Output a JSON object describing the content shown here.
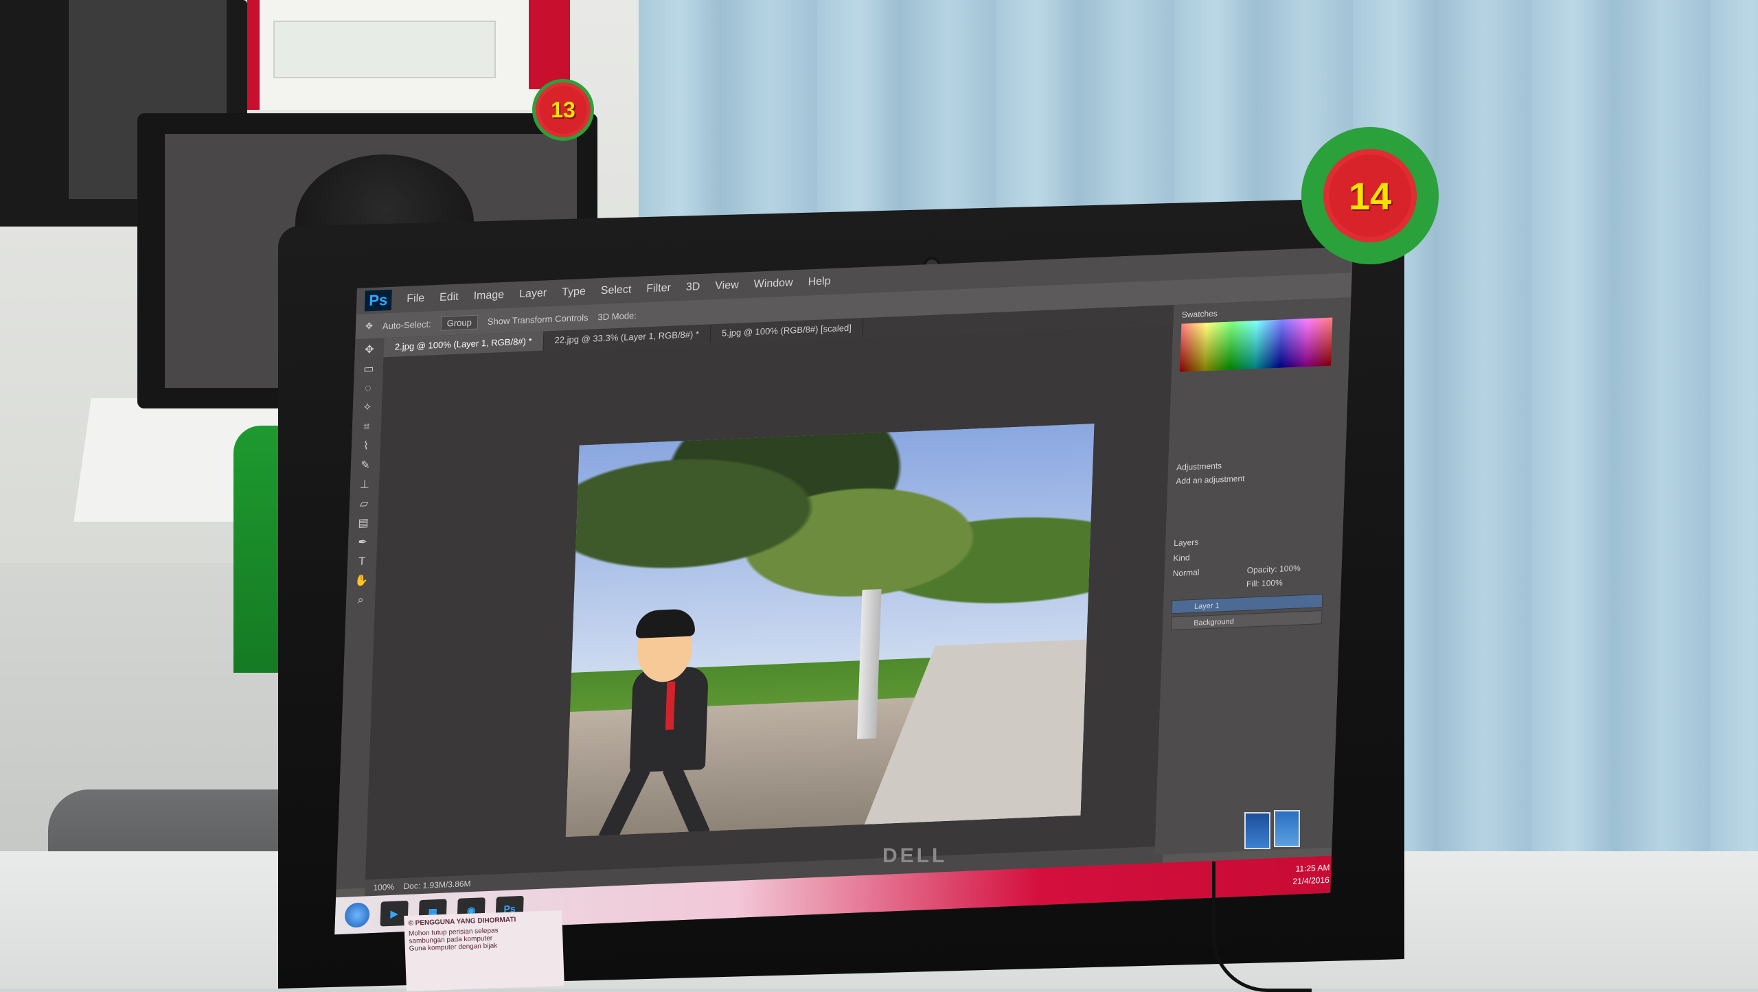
{
  "badges": {
    "back": "13",
    "front": "14"
  },
  "monitor_brand": "DELL",
  "photoshop": {
    "app_logo": "Ps",
    "menu": [
      "File",
      "Edit",
      "Image",
      "Layer",
      "Type",
      "Select",
      "Filter",
      "3D",
      "View",
      "Window",
      "Help"
    ],
    "options": {
      "auto_select": "Auto-Select:",
      "group": "Group",
      "show_transform": "Show Transform Controls",
      "mode_3d": "3D Mode:"
    },
    "tabs": [
      {
        "label": "2.jpg @ 100% (Layer 1, RGB/8#) *",
        "active": true
      },
      {
        "label": "22.jpg @ 33.3% (Layer 1, RGB/8#) *",
        "active": false
      },
      {
        "label": "5.jpg @ 100% (RGB/8#) [scaled]",
        "active": false
      }
    ],
    "panels": {
      "color_tab": "Swatches",
      "adjustments_tab": "Adjustments",
      "adjustments_hint": "Add an adjustment",
      "layers_tab": "Layers",
      "kind": "Kind",
      "normal": "Normal",
      "opacity": "Opacity: 100%",
      "fill": "Fill: 100%",
      "layer_items": [
        {
          "name": "Layer 1",
          "selected": true
        },
        {
          "name": "Background",
          "selected": false
        }
      ]
    },
    "status": {
      "zoom": "100%",
      "doc": "Doc: 1.93M/3.86M"
    },
    "taskbar": {
      "ps_label": "Ps",
      "time": "11:25 AM",
      "date": "21/4/2016"
    }
  },
  "notice": {
    "title": "© PENGGUNA YANG DIHORMATI",
    "lines": [
      "Mohon tutup perisian selepas",
      "sambungan pada komputer",
      "Guna komputer dengan bijak"
    ]
  },
  "colors": {
    "accent_ps": "#31a8ff",
    "badge_green": "#2aa13a",
    "badge_red": "#d8232a",
    "badge_yellow": "#f5e400"
  }
}
